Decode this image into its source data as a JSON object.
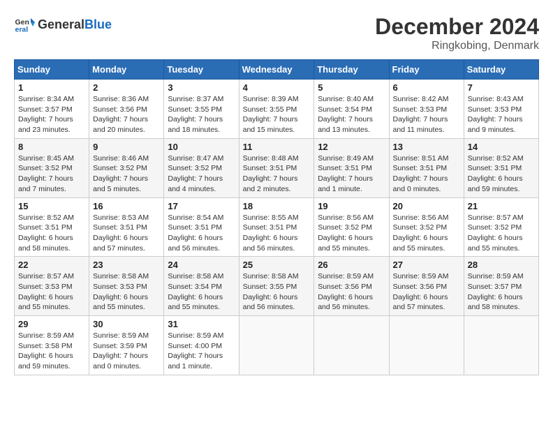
{
  "header": {
    "logo_general": "General",
    "logo_blue": "Blue",
    "month_title": "December 2024",
    "location": "Ringkobing, Denmark"
  },
  "days_of_week": [
    "Sunday",
    "Monday",
    "Tuesday",
    "Wednesday",
    "Thursday",
    "Friday",
    "Saturday"
  ],
  "weeks": [
    [
      {
        "day": 1,
        "sunrise": "8:34 AM",
        "sunset": "3:57 PM",
        "daylight": "7 hours and 23 minutes."
      },
      {
        "day": 2,
        "sunrise": "8:36 AM",
        "sunset": "3:56 PM",
        "daylight": "7 hours and 20 minutes."
      },
      {
        "day": 3,
        "sunrise": "8:37 AM",
        "sunset": "3:55 PM",
        "daylight": "7 hours and 18 minutes."
      },
      {
        "day": 4,
        "sunrise": "8:39 AM",
        "sunset": "3:55 PM",
        "daylight": "7 hours and 15 minutes."
      },
      {
        "day": 5,
        "sunrise": "8:40 AM",
        "sunset": "3:54 PM",
        "daylight": "7 hours and 13 minutes."
      },
      {
        "day": 6,
        "sunrise": "8:42 AM",
        "sunset": "3:53 PM",
        "daylight": "7 hours and 11 minutes."
      },
      {
        "day": 7,
        "sunrise": "8:43 AM",
        "sunset": "3:53 PM",
        "daylight": "7 hours and 9 minutes."
      }
    ],
    [
      {
        "day": 8,
        "sunrise": "8:45 AM",
        "sunset": "3:52 PM",
        "daylight": "7 hours and 7 minutes."
      },
      {
        "day": 9,
        "sunrise": "8:46 AM",
        "sunset": "3:52 PM",
        "daylight": "7 hours and 5 minutes."
      },
      {
        "day": 10,
        "sunrise": "8:47 AM",
        "sunset": "3:52 PM",
        "daylight": "7 hours and 4 minutes."
      },
      {
        "day": 11,
        "sunrise": "8:48 AM",
        "sunset": "3:51 PM",
        "daylight": "7 hours and 2 minutes."
      },
      {
        "day": 12,
        "sunrise": "8:49 AM",
        "sunset": "3:51 PM",
        "daylight": "7 hours and 1 minute."
      },
      {
        "day": 13,
        "sunrise": "8:51 AM",
        "sunset": "3:51 PM",
        "daylight": "7 hours and 0 minutes."
      },
      {
        "day": 14,
        "sunrise": "8:52 AM",
        "sunset": "3:51 PM",
        "daylight": "6 hours and 59 minutes."
      }
    ],
    [
      {
        "day": 15,
        "sunrise": "8:52 AM",
        "sunset": "3:51 PM",
        "daylight": "6 hours and 58 minutes."
      },
      {
        "day": 16,
        "sunrise": "8:53 AM",
        "sunset": "3:51 PM",
        "daylight": "6 hours and 57 minutes."
      },
      {
        "day": 17,
        "sunrise": "8:54 AM",
        "sunset": "3:51 PM",
        "daylight": "6 hours and 56 minutes."
      },
      {
        "day": 18,
        "sunrise": "8:55 AM",
        "sunset": "3:51 PM",
        "daylight": "6 hours and 56 minutes."
      },
      {
        "day": 19,
        "sunrise": "8:56 AM",
        "sunset": "3:52 PM",
        "daylight": "6 hours and 55 minutes."
      },
      {
        "day": 20,
        "sunrise": "8:56 AM",
        "sunset": "3:52 PM",
        "daylight": "6 hours and 55 minutes."
      },
      {
        "day": 21,
        "sunrise": "8:57 AM",
        "sunset": "3:52 PM",
        "daylight": "6 hours and 55 minutes."
      }
    ],
    [
      {
        "day": 22,
        "sunrise": "8:57 AM",
        "sunset": "3:53 PM",
        "daylight": "6 hours and 55 minutes."
      },
      {
        "day": 23,
        "sunrise": "8:58 AM",
        "sunset": "3:53 PM",
        "daylight": "6 hours and 55 minutes."
      },
      {
        "day": 24,
        "sunrise": "8:58 AM",
        "sunset": "3:54 PM",
        "daylight": "6 hours and 55 minutes."
      },
      {
        "day": 25,
        "sunrise": "8:58 AM",
        "sunset": "3:55 PM",
        "daylight": "6 hours and 56 minutes."
      },
      {
        "day": 26,
        "sunrise": "8:59 AM",
        "sunset": "3:56 PM",
        "daylight": "6 hours and 56 minutes."
      },
      {
        "day": 27,
        "sunrise": "8:59 AM",
        "sunset": "3:56 PM",
        "daylight": "6 hours and 57 minutes."
      },
      {
        "day": 28,
        "sunrise": "8:59 AM",
        "sunset": "3:57 PM",
        "daylight": "6 hours and 58 minutes."
      }
    ],
    [
      {
        "day": 29,
        "sunrise": "8:59 AM",
        "sunset": "3:58 PM",
        "daylight": "6 hours and 59 minutes."
      },
      {
        "day": 30,
        "sunrise": "8:59 AM",
        "sunset": "3:59 PM",
        "daylight": "7 hours and 0 minutes."
      },
      {
        "day": 31,
        "sunrise": "8:59 AM",
        "sunset": "4:00 PM",
        "daylight": "7 hours and 1 minute."
      },
      null,
      null,
      null,
      null
    ]
  ],
  "labels": {
    "sunrise_prefix": "Sunrise: ",
    "sunset_prefix": "Sunset: ",
    "daylight_prefix": "Daylight: "
  }
}
